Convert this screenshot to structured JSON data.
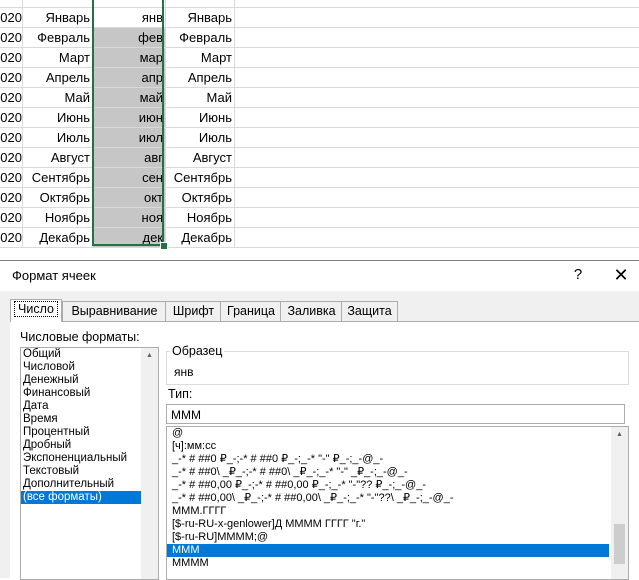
{
  "sheet": {
    "rows": [
      {
        "a": "020",
        "b": "Январь",
        "c": "янв",
        "d": "Январь"
      },
      {
        "a": "020",
        "b": "Февраль",
        "c": "фев",
        "d": "Февраль"
      },
      {
        "a": "020",
        "b": "Март",
        "c": "мар",
        "d": "Март"
      },
      {
        "a": "020",
        "b": "Апрель",
        "c": "апр",
        "d": "Апрель"
      },
      {
        "a": "020",
        "b": "Май",
        "c": "май",
        "d": "Май"
      },
      {
        "a": "020",
        "b": "Июнь",
        "c": "июн",
        "d": "Июнь"
      },
      {
        "a": "020",
        "b": "Июль",
        "c": "июл",
        "d": "Июль"
      },
      {
        "a": "020",
        "b": "Август",
        "c": "авг",
        "d": "Август"
      },
      {
        "a": "020",
        "b": "Сентябрь",
        "c": "сен",
        "d": "Сентябрь"
      },
      {
        "a": "020",
        "b": "Октябрь",
        "c": "окт",
        "d": "Октябрь"
      },
      {
        "a": "020",
        "b": "Ноябрь",
        "c": "ноя",
        "d": "Ноябрь"
      },
      {
        "a": "020",
        "b": "Декабрь",
        "c": "дек",
        "d": "Декабрь"
      }
    ],
    "selection_color": "#217346"
  },
  "dialog": {
    "title": "Формат ячеек",
    "help_label": "?",
    "close_label": "✕",
    "tabs": [
      {
        "label": "Число"
      },
      {
        "label": "Выравнивание"
      },
      {
        "label": "Шрифт"
      },
      {
        "label": "Граница"
      },
      {
        "label": "Заливка"
      },
      {
        "label": "Защита"
      }
    ],
    "formats_label": "Числовые форматы:",
    "categories": [
      "Общий",
      "Числовой",
      "Денежный",
      "Финансовый",
      "Дата",
      "Время",
      "Процентный",
      "Дробный",
      "Экспоненциальный",
      "Текстовый",
      "Дополнительный",
      "(все форматы)"
    ],
    "selected_category": "(все форматы)",
    "sample_label": "Образец",
    "sample_value": "янв",
    "type_label": "Тип:",
    "type_value": "МММ",
    "format_codes": [
      "@",
      "[ч]:мм:сс",
      "_-* # ##0 ₽_-;-* # ##0 ₽_-;_-* \"-\" ₽_-;_-@_-",
      "_-* # ##0\\ _₽_-;-* # ##0\\ _₽_-;_-* \"-\" _₽_-;_-@_-",
      "_-* # ##0,00 ₽_-;-* # ##0,00 ₽_-;_-* \"-\"?? ₽_-;_-@_-",
      "_-* # ##0,00\\ _₽_-;-* # ##0,00\\ _₽_-;_-* \"-\"??\\ _₽_-;_-@_-",
      "МММ.ГГГГ",
      "[$-ru-RU-x-genlower]Д ММММ ГГГГ \"г.\"",
      "[$-ru-RU]ММММ;@",
      "МММ",
      "ММММ"
    ],
    "selected_format": "МММ",
    "accent_color": "#0078d7"
  }
}
